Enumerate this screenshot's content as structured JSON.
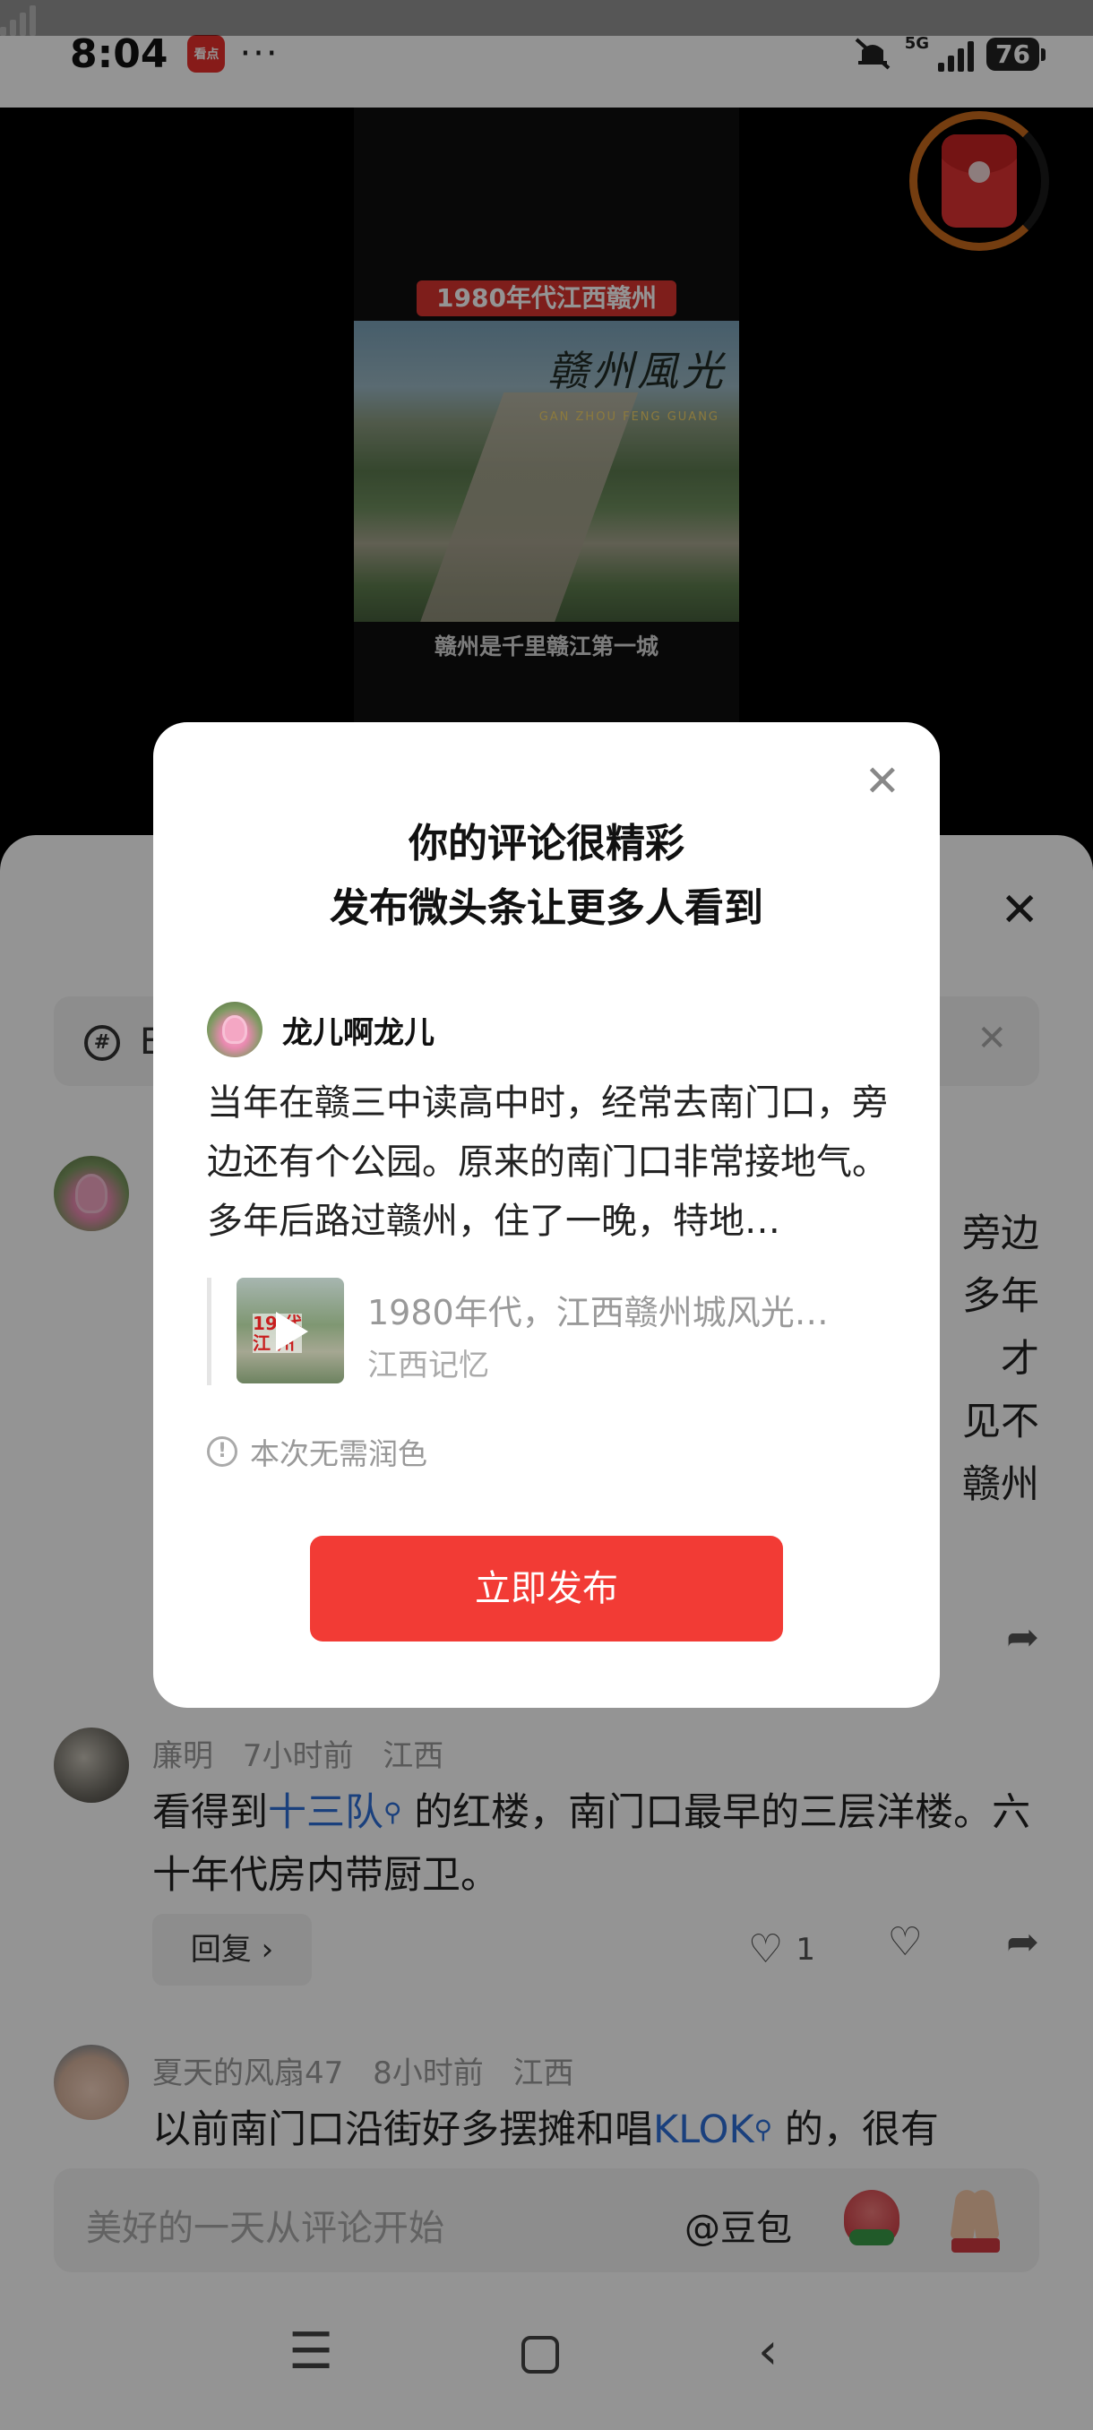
{
  "status_bar": {
    "time": "8:04",
    "app_badge": "看点",
    "more": "···",
    "network": "5G",
    "battery": "76"
  },
  "video": {
    "caption_top": "1980年代江西赣州",
    "calligraphy": "赣州風光",
    "pinyin": "GAN ZHOU FENG GUANG",
    "caption_bottom": "赣州是千里赣江第一城"
  },
  "sheet": {
    "topic_prefix": "🄴",
    "close_icon": "✕"
  },
  "first_comment": {
    "partial_lines": [
      "旁边",
      "多年",
      "才",
      "见不",
      "赣州"
    ]
  },
  "comments": [
    {
      "user": "廉明",
      "time": "7小时前",
      "location": "江西",
      "text_before": "看得到",
      "link": "十三队",
      "text_after": "的红楼，南门口最早的三层洋楼。六十年代房内带厨卫。",
      "reply_label": "回复 ›",
      "likes": "1"
    },
    {
      "user": "夏天的风扇47",
      "time": "8小时前",
      "location": "江西",
      "text_before": "以前南门口沿街好多摆摊和唱",
      "link": "KLOK",
      "text_after": "的，很有"
    }
  ],
  "input_bar": {
    "placeholder": "美好的一天从评论开始",
    "mention": "@豆包"
  },
  "modal": {
    "title_line1": "你的评论很精彩",
    "title_line2": "发布微头条让更多人看到",
    "username": "龙儿啊龙儿",
    "comment_text": "当年在赣三中读高中时，经常去南门口，旁边还有个公园。原来的南门口非常接地气。多年后路过赣州，住了一晚，特地…",
    "ref_title": "1980年代，江西赣州城风光…",
    "ref_source": "江西记忆",
    "ref_thumb_tag": "19 代\n江 州",
    "note": "本次无需润色",
    "publish_label": "立即发布"
  },
  "colors": {
    "accent_red": "#f23b35",
    "link_blue": "#2e6fd8"
  }
}
